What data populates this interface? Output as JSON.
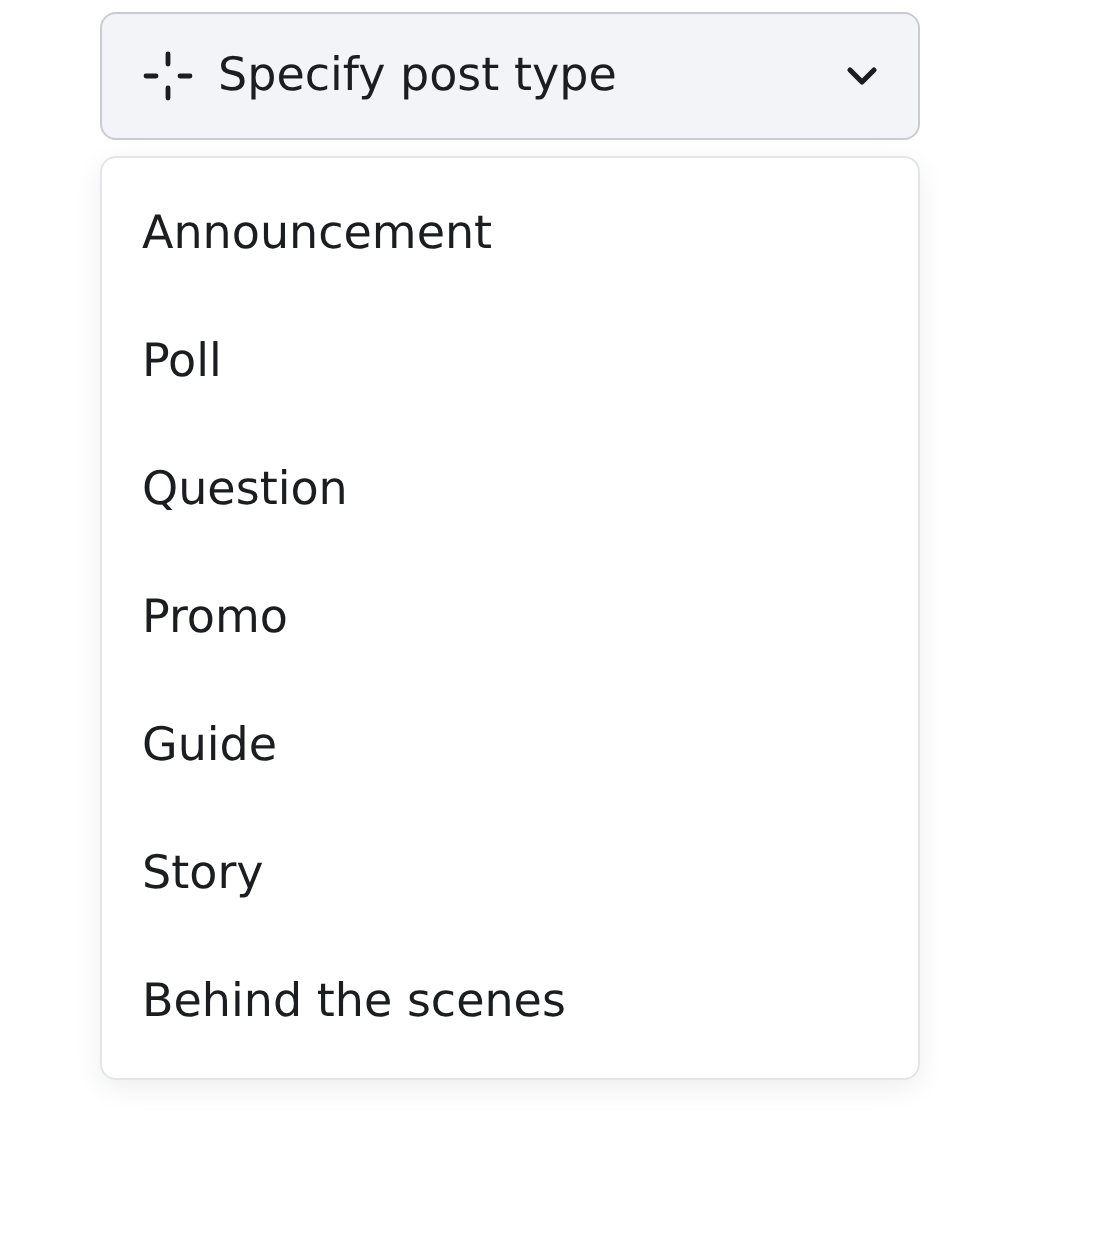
{
  "trigger": {
    "label": "Specify post type",
    "expanded": true
  },
  "menu": {
    "items": [
      {
        "label": "Announcement",
        "selected": false
      },
      {
        "label": "Poll",
        "selected": false
      },
      {
        "label": "Question",
        "selected": false
      },
      {
        "label": "Promo",
        "selected": false
      },
      {
        "label": "Guide",
        "selected": false
      },
      {
        "label": "Story",
        "selected": false
      },
      {
        "label": "Behind the scenes",
        "selected": false
      }
    ]
  }
}
